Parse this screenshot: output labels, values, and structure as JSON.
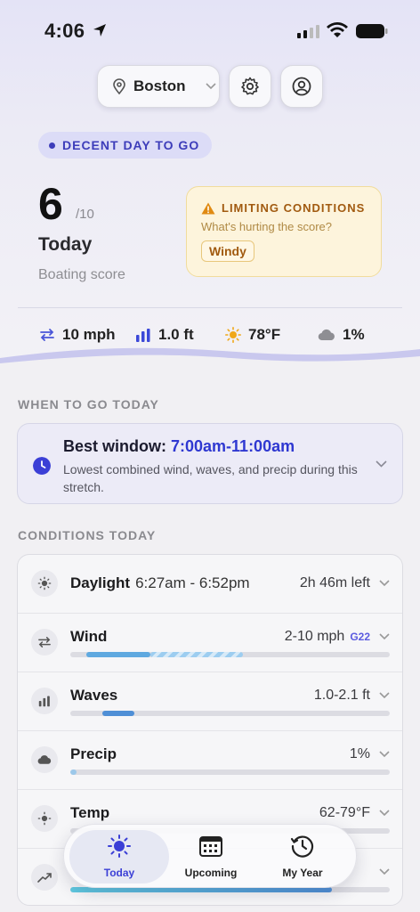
{
  "status_bar": {
    "time": "4:06"
  },
  "header": {
    "city": "Boston"
  },
  "hero": {
    "badge": "DECENT DAY TO GO",
    "score": "6",
    "score_max": "/10",
    "day": "Today",
    "score_label": "Boating score",
    "limiting": {
      "title": "LIMITING CONDITIONS",
      "subtitle": "What's hurting the score?",
      "tag": "Windy"
    },
    "stats": {
      "wind": "10 mph",
      "waves": "1.0 ft",
      "temp": "78°F",
      "precip": "1%"
    }
  },
  "when_section": {
    "title": "WHEN TO GO TODAY",
    "best_label": "Best window: ",
    "best_time": "7:00am-11:00am",
    "description": "Lowest combined wind, waves, and precip during this stretch."
  },
  "conditions": {
    "title": "CONDITIONS TODAY",
    "rows": [
      {
        "label": "Daylight",
        "extra": "6:27am - 6:52pm",
        "value": "2h 46m left",
        "icon": "sun-icon"
      },
      {
        "label": "Wind",
        "value": "2-10 mph",
        "gust": "G22",
        "icon": "wind-icon",
        "bar": {
          "start": 0.05,
          "end": 0.25,
          "gust_end": 0.54
        }
      },
      {
        "label": "Waves",
        "value": "1.0-2.1 ft",
        "icon": "waves-icon",
        "bar": {
          "start": 0.1,
          "end": 0.2
        }
      },
      {
        "label": "Precip",
        "value": "1%",
        "icon": "cloud-icon",
        "bar": {
          "start": 0.0,
          "end": 0.02
        }
      },
      {
        "label": "Temp",
        "value": "62-79°F",
        "icon": "thermo-icon"
      },
      {
        "label": "",
        "value": "",
        "icon": "trend-icon"
      }
    ]
  },
  "tabs": [
    {
      "label": "Today",
      "icon": "sun-icon",
      "active": true
    },
    {
      "label": "Upcoming",
      "icon": "calendar-icon",
      "active": false
    },
    {
      "label": "My Year",
      "icon": "history-icon",
      "active": false
    }
  ],
  "colors": {
    "accent": "#3b3fd6",
    "warning": "#a15a10",
    "wind_bar": "#5fa9e0"
  }
}
